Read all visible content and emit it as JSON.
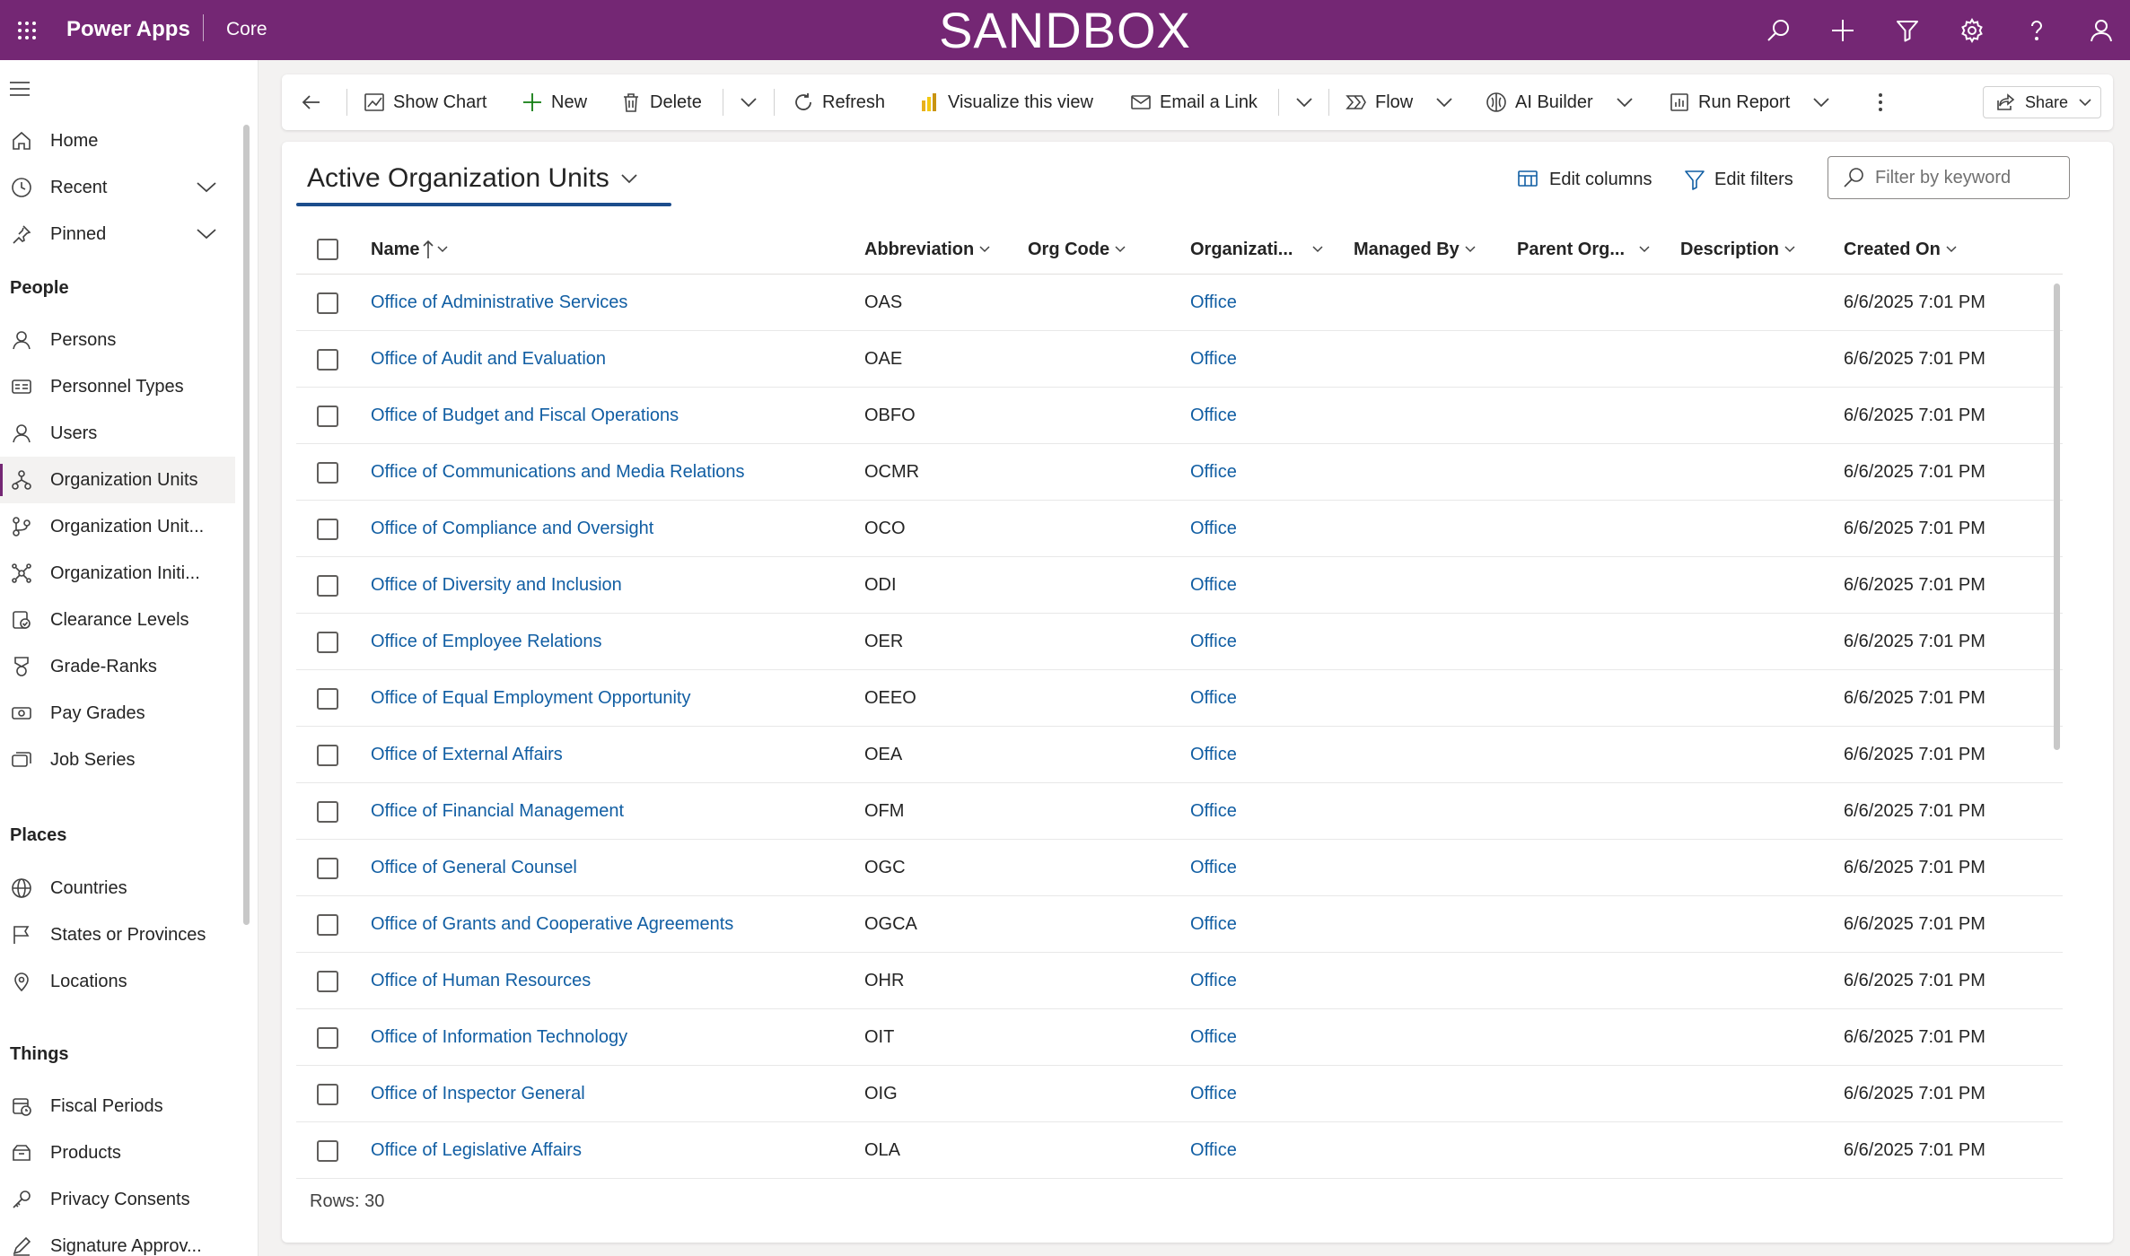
{
  "topbar": {
    "app_name": "Power Apps",
    "environment": "Core",
    "banner": "SANDBOX",
    "icons": [
      "search-icon",
      "plus-icon",
      "filter-icon",
      "settings-icon",
      "help-icon",
      "user-icon"
    ],
    "brand_color": "#742774"
  },
  "sidebar": {
    "top_items": [
      {
        "label": "Home",
        "icon": "home-icon"
      },
      {
        "label": "Recent",
        "icon": "clock-icon",
        "expandable": true
      },
      {
        "label": "Pinned",
        "icon": "pin-icon",
        "expandable": true
      }
    ],
    "groups": [
      {
        "title": "People",
        "items": [
          {
            "label": "Persons",
            "icon": "person-icon"
          },
          {
            "label": "Personnel Types",
            "icon": "id-card-icon"
          },
          {
            "label": "Users",
            "icon": "person-icon"
          },
          {
            "label": "Organization Units",
            "icon": "org-chart-icon",
            "selected": true
          },
          {
            "label": "Organization Unit...",
            "icon": "branch-icon"
          },
          {
            "label": "Organization Initi...",
            "icon": "network-icon"
          },
          {
            "label": "Clearance Levels",
            "icon": "shield-check-icon"
          },
          {
            "label": "Grade-Ranks",
            "icon": "medal-icon"
          },
          {
            "label": "Pay Grades",
            "icon": "money-icon"
          },
          {
            "label": "Job Series",
            "icon": "stack-icon"
          }
        ]
      },
      {
        "title": "Places",
        "items": [
          {
            "label": "Countries",
            "icon": "globe-icon"
          },
          {
            "label": "States or Provinces",
            "icon": "flag-icon"
          },
          {
            "label": "Locations",
            "icon": "location-pin-icon"
          }
        ]
      },
      {
        "title": "Things",
        "items": [
          {
            "label": "Fiscal Periods",
            "icon": "calendar-icon"
          },
          {
            "label": "Products",
            "icon": "box-icon"
          },
          {
            "label": "Privacy Consents",
            "icon": "key-icon"
          },
          {
            "label": "Signature Approv...",
            "icon": "signature-icon"
          }
        ]
      }
    ]
  },
  "commandbar": {
    "show_chart": "Show Chart",
    "new": "New",
    "delete": "Delete",
    "refresh": "Refresh",
    "visualize": "Visualize this view",
    "email_link": "Email a Link",
    "flow": "Flow",
    "ai_builder": "AI Builder",
    "run_report": "Run Report",
    "share": "Share"
  },
  "view": {
    "title": "Active Organization Units",
    "edit_columns": "Edit columns",
    "edit_filters": "Edit filters",
    "filter_placeholder": "Filter by keyword",
    "rows_label": "Rows: 30",
    "columns": [
      "Name",
      "Abbreviation",
      "Org Code",
      "Organizati...",
      "Managed By",
      "Parent Org...",
      "Description",
      "Created On"
    ],
    "rows": [
      {
        "name": "Office of Administrative Services",
        "abbr": "OAS",
        "org_code": "",
        "org_type": "Office",
        "managed_by": "",
        "parent": "",
        "description": "",
        "created_on": "6/6/2025 7:01 PM"
      },
      {
        "name": "Office of Audit and Evaluation",
        "abbr": "OAE",
        "org_code": "",
        "org_type": "Office",
        "managed_by": "",
        "parent": "",
        "description": "",
        "created_on": "6/6/2025 7:01 PM"
      },
      {
        "name": "Office of Budget and Fiscal Operations",
        "abbr": "OBFO",
        "org_code": "",
        "org_type": "Office",
        "managed_by": "",
        "parent": "",
        "description": "",
        "created_on": "6/6/2025 7:01 PM"
      },
      {
        "name": "Office of Communications and Media Relations",
        "abbr": "OCMR",
        "org_code": "",
        "org_type": "Office",
        "managed_by": "",
        "parent": "",
        "description": "",
        "created_on": "6/6/2025 7:01 PM"
      },
      {
        "name": "Office of Compliance and Oversight",
        "abbr": "OCO",
        "org_code": "",
        "org_type": "Office",
        "managed_by": "",
        "parent": "",
        "description": "",
        "created_on": "6/6/2025 7:01 PM"
      },
      {
        "name": "Office of Diversity and Inclusion",
        "abbr": "ODI",
        "org_code": "",
        "org_type": "Office",
        "managed_by": "",
        "parent": "",
        "description": "",
        "created_on": "6/6/2025 7:01 PM"
      },
      {
        "name": "Office of Employee Relations",
        "abbr": "OER",
        "org_code": "",
        "org_type": "Office",
        "managed_by": "",
        "parent": "",
        "description": "",
        "created_on": "6/6/2025 7:01 PM"
      },
      {
        "name": "Office of Equal Employment Opportunity",
        "abbr": "OEEO",
        "org_code": "",
        "org_type": "Office",
        "managed_by": "",
        "parent": "",
        "description": "",
        "created_on": "6/6/2025 7:01 PM"
      },
      {
        "name": "Office of External Affairs",
        "abbr": "OEA",
        "org_code": "",
        "org_type": "Office",
        "managed_by": "",
        "parent": "",
        "description": "",
        "created_on": "6/6/2025 7:01 PM"
      },
      {
        "name": "Office of Financial Management",
        "abbr": "OFM",
        "org_code": "",
        "org_type": "Office",
        "managed_by": "",
        "parent": "",
        "description": "",
        "created_on": "6/6/2025 7:01 PM"
      },
      {
        "name": "Office of General Counsel",
        "abbr": "OGC",
        "org_code": "",
        "org_type": "Office",
        "managed_by": "",
        "parent": "",
        "description": "",
        "created_on": "6/6/2025 7:01 PM"
      },
      {
        "name": "Office of Grants and Cooperative Agreements",
        "abbr": "OGCA",
        "org_code": "",
        "org_type": "Office",
        "managed_by": "",
        "parent": "",
        "description": "",
        "created_on": "6/6/2025 7:01 PM"
      },
      {
        "name": "Office of Human Resources",
        "abbr": "OHR",
        "org_code": "",
        "org_type": "Office",
        "managed_by": "",
        "parent": "",
        "description": "",
        "created_on": "6/6/2025 7:01 PM"
      },
      {
        "name": "Office of Information Technology",
        "abbr": "OIT",
        "org_code": "",
        "org_type": "Office",
        "managed_by": "",
        "parent": "",
        "description": "",
        "created_on": "6/6/2025 7:01 PM"
      },
      {
        "name": "Office of Inspector General",
        "abbr": "OIG",
        "org_code": "",
        "org_type": "Office",
        "managed_by": "",
        "parent": "",
        "description": "",
        "created_on": "6/6/2025 7:01 PM"
      },
      {
        "name": "Office of Legislative Affairs",
        "abbr": "OLA",
        "org_code": "",
        "org_type": "Office",
        "managed_by": "",
        "parent": "",
        "description": "",
        "created_on": "6/6/2025 7:01 PM"
      }
    ]
  }
}
